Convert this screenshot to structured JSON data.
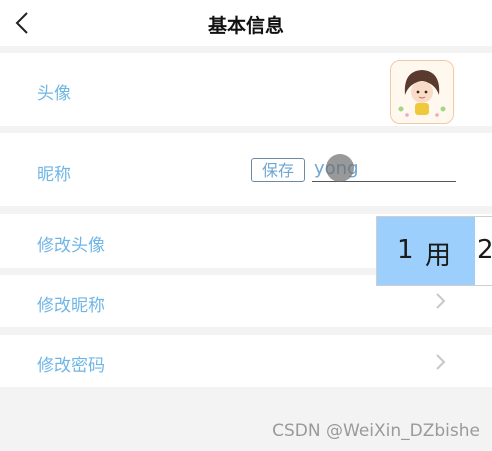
{
  "header": {
    "title": "基本信息"
  },
  "rows": {
    "avatar": {
      "label": "头像"
    },
    "nickname": {
      "label": "昵称",
      "save_label": "保存",
      "input_value": "yong"
    },
    "edit_avatar": {
      "label": "修改头像"
    },
    "edit_nickname": {
      "label": "修改昵称"
    },
    "edit_password": {
      "label": "修改密码"
    }
  },
  "ime": {
    "candidate_index": "1",
    "candidate_text": "用",
    "next_candidate": "2"
  },
  "watermark": "CSDN @WeiXin_DZbishe",
  "colors": {
    "label": "#6fb6e6",
    "background": "#f3f3f3",
    "ime_highlight": "#9ccffb"
  },
  "icons": {
    "back": "chevron-left-icon",
    "row_arrow": "chevron-right-icon"
  }
}
